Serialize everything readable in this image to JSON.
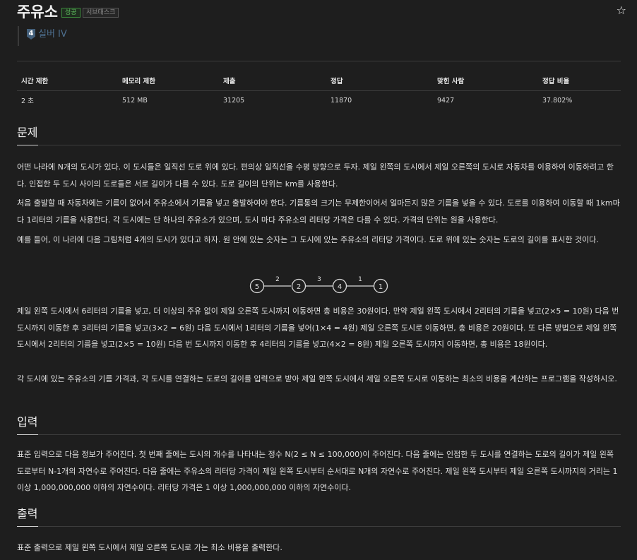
{
  "header": {
    "title": "주유소",
    "badge_status": "성공",
    "badge_service": "서브태스크",
    "star_icon": "☆"
  },
  "tier": {
    "level": "4",
    "label": "실버 IV",
    "color": "#435f7a"
  },
  "info_table": {
    "headers": [
      "시간 제한",
      "메모리 제한",
      "제출",
      "정답",
      "맞힌 사람",
      "정답 비율"
    ],
    "row": [
      "2 초",
      "512 MB",
      "31205",
      "11870",
      "9427",
      "37.802%"
    ]
  },
  "sections": {
    "problem": {
      "title": "문제",
      "p1": "어떤 나라에 N개의 도시가 있다. 이 도시들은 일직선 도로 위에 있다. 편의상 일직선을 수평 방향으로 두자. 제일 왼쪽의 도시에서 제일 오른쪽의 도시로 자동차를 이용하여 이동하려고 한다. 인접한 두 도시 사이의 도로들은 서로 길이가 다를 수 있다. 도로 길이의 단위는 km를 사용한다.",
      "p2": "처음 출발할 때 자동차에는 기름이 없어서 주유소에서 기름을 넣고 출발하여야 한다. 기름통의 크기는 무제한이어서 얼마든지 많은 기름을 넣을 수 있다. 도로를 이용하여 이동할 때 1km마다 1리터의 기름을 사용한다. 각 도시에는 단 하나의 주유소가 있으며, 도시 마다 주유소의 리터당 가격은 다를 수 있다. 가격의 단위는 원을 사용한다.",
      "p3": "예를 들어, 이 나라에 다음 그림처럼 4개의 도시가 있다고 하자. 원 안에 있는 숫자는 그 도시에 있는 주유소의 리터당 가격이다. 도로 위에 있는 숫자는 도로의 길이를 표시한 것이다.",
      "figure": {
        "nodes": [
          "5",
          "2",
          "4",
          "1"
        ],
        "roads": [
          "2",
          "3",
          "1"
        ]
      },
      "p4": "제일 왼쪽 도시에서 6리터의 기름을 넣고, 더 이상의 주유 없이 제일 오른쪽 도시까지 이동하면 총 비용은 30원이다. 만약 제일 왼쪽 도시에서 2리터의 기름을 넣고(2×5 = 10원) 다음 번 도시까지 이동한 후 3리터의 기름을 넣고(3×2 = 6원) 다음 도시에서 1리터의 기름을 넣어(1×4 = 4원) 제일 오른쪽 도시로 이동하면, 총 비용은 20원이다. 또 다른 방법으로 제일 왼쪽 도시에서 2리터의 기름을 넣고(2×5 = 10원) 다음 번 도시까지 이동한 후 4리터의 기름을 넣고(4×2 = 8원) 제일 오른쪽 도시까지 이동하면, 총 비용은 18원이다.",
      "p5": "각 도시에 있는 주유소의 기름 가격과, 각 도시를 연결하는 도로의 길이를 입력으로 받아 제일 왼쪽 도시에서 제일 오른쪽 도시로 이동하는 최소의 비용을 계산하는 프로그램을 작성하시오."
    },
    "input": {
      "title": "입력",
      "p1": "표준 입력으로 다음 정보가 주어진다. 첫 번째 줄에는 도시의 개수를 나타내는 정수 N(2 ≤ N ≤ 100,000)이 주어진다. 다음 줄에는 인접한 두 도시를 연결하는 도로의 길이가 제일 왼쪽 도로부터 N-1개의 자연수로 주어진다. 다음 줄에는 주유소의 리터당 가격이 제일 왼쪽 도시부터 순서대로 N개의 자연수로 주어진다. 제일 왼쪽 도시부터 제일 오른쪽 도시까지의 거리는 1이상 1,000,000,000 이하의 자연수이다. 리터당 가격은 1 이상 1,000,000,000 이하의 자연수이다."
    },
    "output": {
      "title": "출력",
      "p1": "표준 출력으로 제일 왼쪽 도시에서 제일 오른쪽 도시로 가는 최소 비용을 출력한다."
    }
  }
}
